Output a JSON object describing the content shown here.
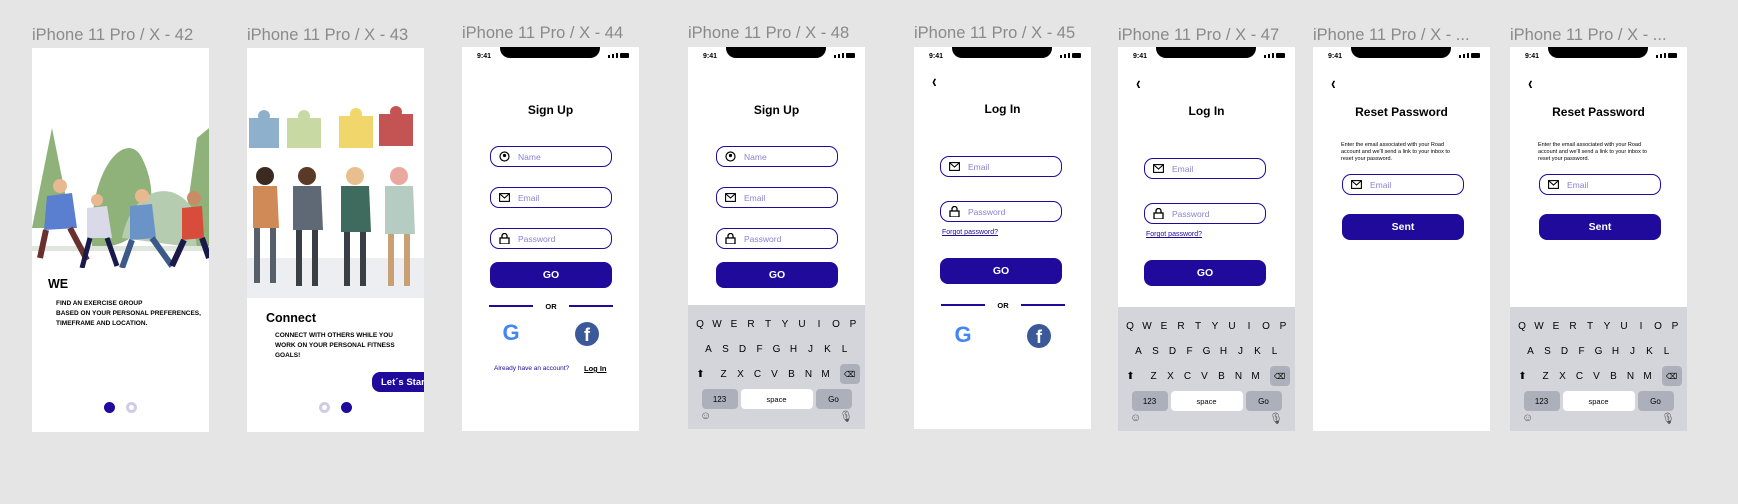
{
  "status": {
    "time": "9:41"
  },
  "frames": [
    {
      "label": "iPhone 11 Pro / X - 42"
    },
    {
      "label": "iPhone 11 Pro / X - 43"
    },
    {
      "label": "iPhone 11 Pro / X - 44"
    },
    {
      "label": "iPhone 11 Pro / X - 48"
    },
    {
      "label": "iPhone 11 Pro / X - 45"
    },
    {
      "label": "iPhone 11 Pro / X - 47"
    },
    {
      "label": "iPhone 11 Pro / X - ..."
    },
    {
      "label": "iPhone 11 Pro / X - ..."
    }
  ],
  "onboarding1": {
    "heading": "WE",
    "text1": "FIND AN EXERCISE GROUP",
    "text2": "BASED ON YOUR PERSONAL PREFERENCES,",
    "text3": "TIMEFRAME AND LOCATION."
  },
  "onboarding2": {
    "heading": "Connect",
    "text1": "CONNECT WITH OTHERS WHILE YOU",
    "text2": "WORK ON YOUR PERSONAL FITNESS",
    "text3": "GOALS!",
    "start_label": "Let´s Start"
  },
  "signup": {
    "title": "Sign Up",
    "name_placeholder": "Name",
    "email_placeholder": "Email",
    "password_placeholder": "Password",
    "go_label": "GO",
    "or_label": "OR",
    "google_glyph": "G",
    "facebook_glyph": "f",
    "have_account": "Already have an account?",
    "login_link": "Log In"
  },
  "login": {
    "title": "Log In",
    "email_placeholder": "Email",
    "password_placeholder": "Password",
    "forgot": "Forgot password?",
    "go_label": "GO",
    "or_label": "OR"
  },
  "reset": {
    "title": "Reset Password",
    "desc1": "Enter the email associated with your Road",
    "desc2": "account and we'll send a link to your inbox to",
    "desc3": "reset your password.",
    "email_placeholder": "Email",
    "sent_label": "Sent"
  },
  "keyboard": {
    "row1": [
      "Q",
      "W",
      "E",
      "R",
      "T",
      "Y",
      "U",
      "I",
      "O",
      "P"
    ],
    "row2": [
      "A",
      "S",
      "D",
      "F",
      "G",
      "H",
      "J",
      "K",
      "L"
    ],
    "row3": [
      "Z",
      "X",
      "C",
      "V",
      "B",
      "N",
      "M"
    ],
    "numbers": "123",
    "space": "space",
    "go": "Go"
  },
  "colors": {
    "brand": "#1f0a9c",
    "placeholder": "#8a82d6",
    "canvas": "#e5e5e5"
  }
}
